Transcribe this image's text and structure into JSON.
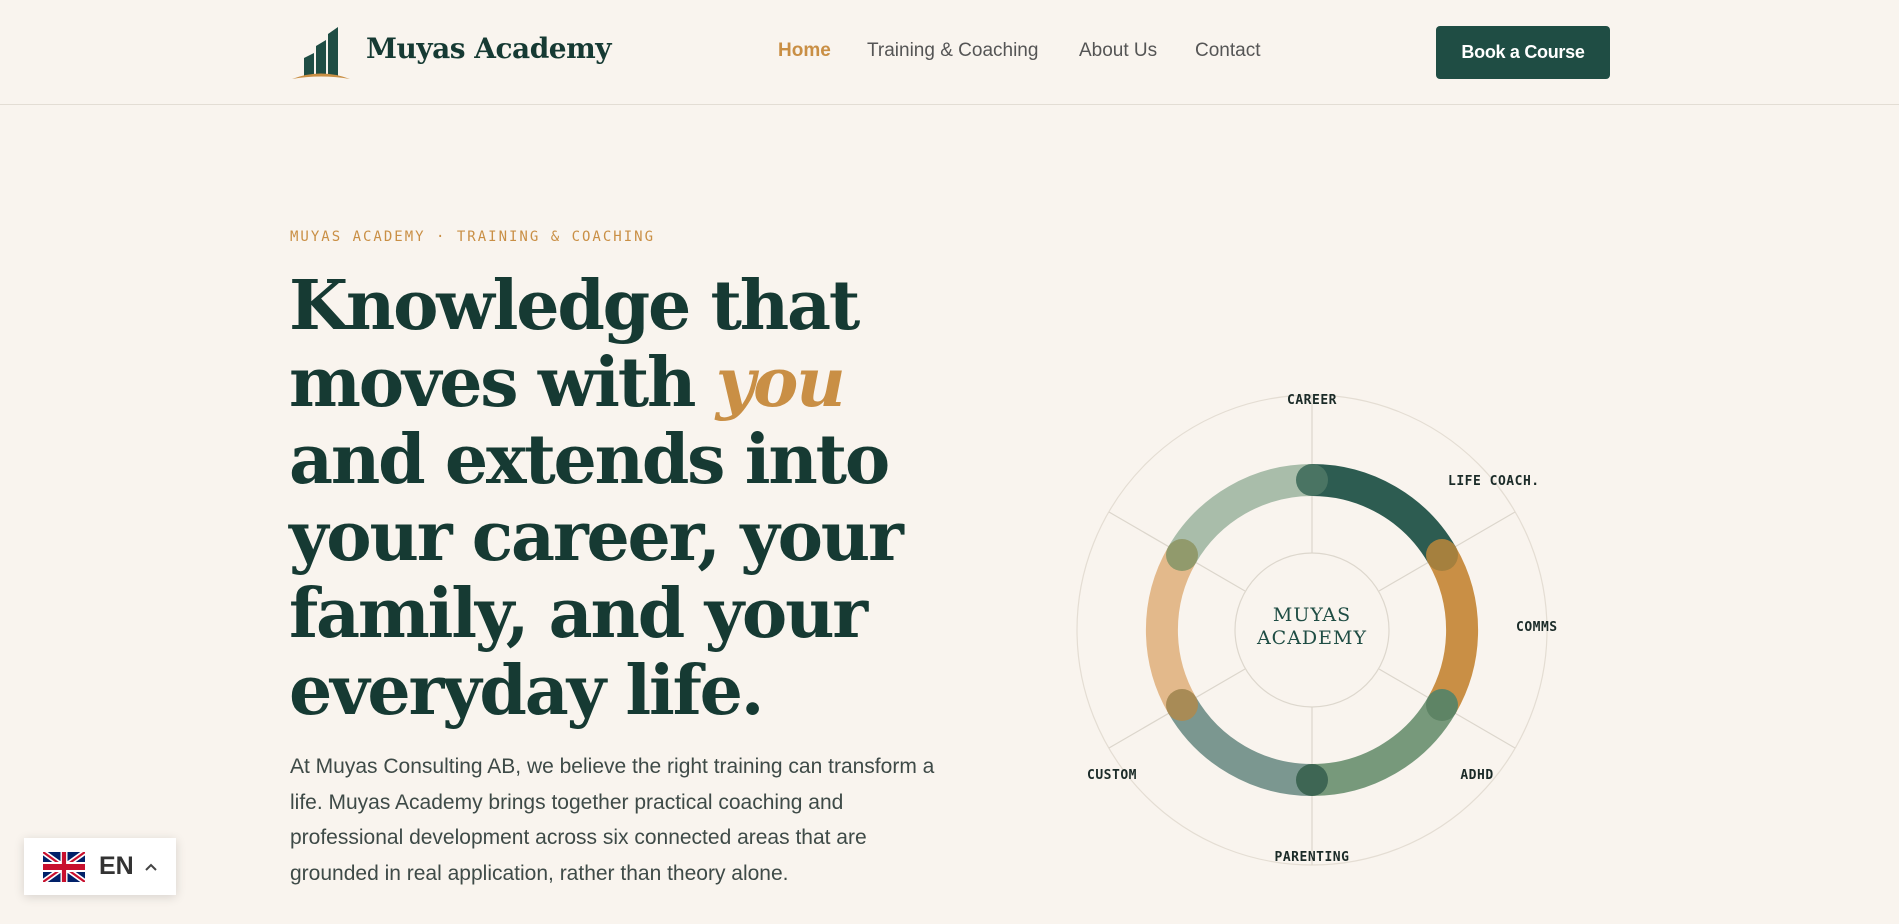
{
  "header": {
    "brand": "Muyas Academy",
    "nav": [
      {
        "label": "Home",
        "active": true
      },
      {
        "label": "Training & Coaching",
        "active": false
      },
      {
        "label": "About Us",
        "active": false
      },
      {
        "label": "Contact",
        "active": false
      }
    ],
    "cta_label": "Book a Course"
  },
  "hero": {
    "eyebrow": "MUYAS ACADEMY · TRAINING & COACHING",
    "headline_before": "Knowledge that moves with ",
    "headline_accent": "you",
    "headline_after": " and extends into your career, your family, and your everyday life.",
    "lead": "At Muyas Consulting AB, we believe the right training can transform a life. Muyas Academy brings together practical coaching and professional development across six connected areas that are grounded in real application, rather than theory alone."
  },
  "diagram": {
    "center_line1": "MUYAS",
    "center_line2": "ACADEMY",
    "segments": [
      {
        "label": "CAREER",
        "color": "#a9bdaa"
      },
      {
        "label": "LIFE COACH.",
        "color": "#2d5c51"
      },
      {
        "label": "COMMS",
        "color": "#c98f45"
      },
      {
        "label": "ADHD",
        "color": "#77997b"
      },
      {
        "label": "PARENTING",
        "color": "#7b9790"
      },
      {
        "label": "CUSTOM",
        "color": "#e3b98b"
      }
    ]
  },
  "language": {
    "code": "EN",
    "flag": "uk-flag-icon"
  },
  "colors": {
    "background": "#f9f4ee",
    "primary": "#1f4d44",
    "accent": "#c98f45",
    "text_dark": "#163a33"
  }
}
